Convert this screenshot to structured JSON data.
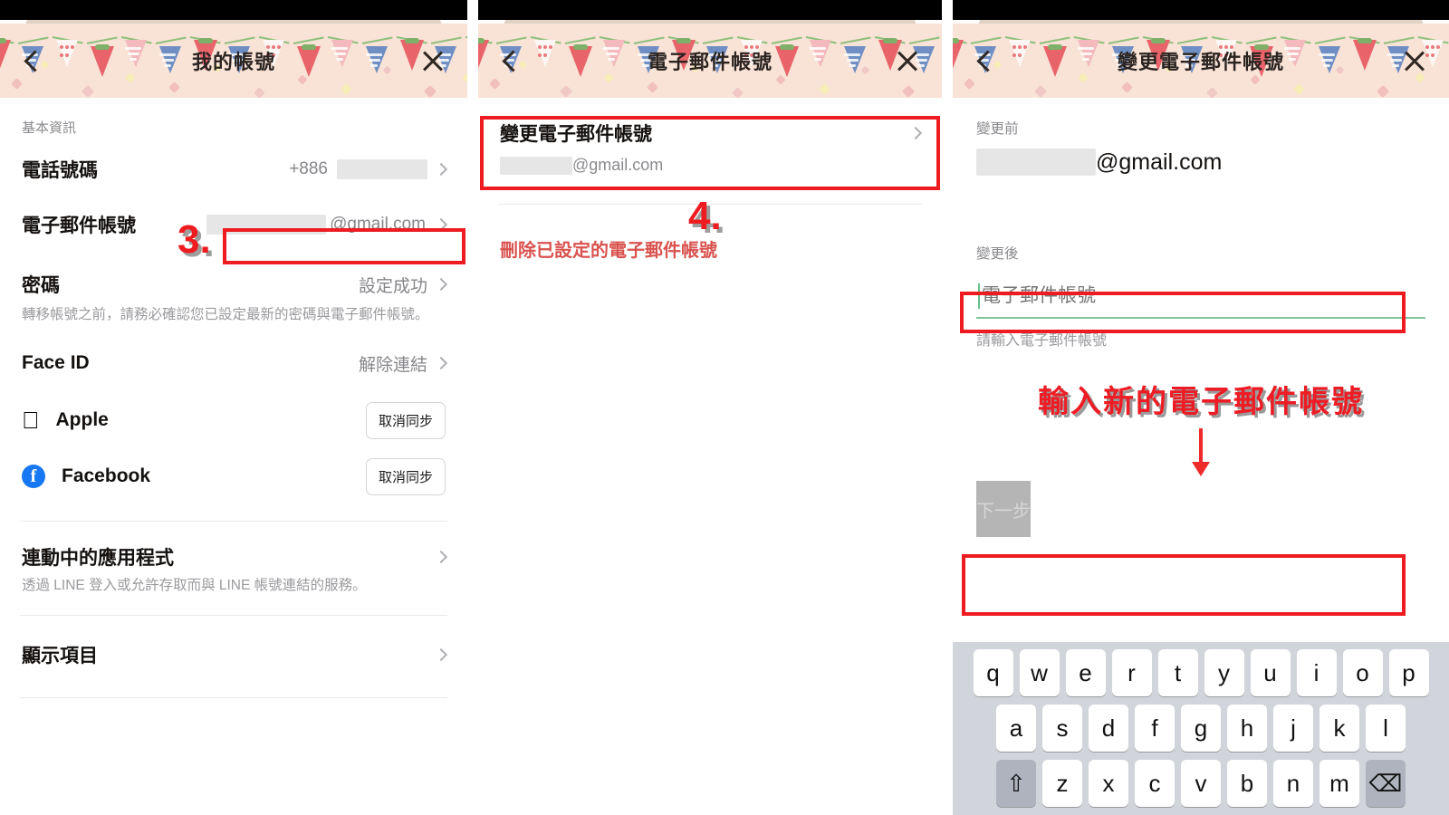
{
  "panels": [
    {
      "id": "my-account",
      "header": {
        "title": "我的帳號",
        "back_icon": "chevron-left-icon",
        "close_icon": "close-icon"
      },
      "section_label": "基本資訊",
      "rows": [
        {
          "title": "電話號碼",
          "value_prefix": "+886",
          "value": "",
          "redacted": true,
          "chevron": true
        },
        {
          "title": "電子郵件帳號",
          "value_prefix": "",
          "value": "@gmail.com",
          "redacted": true,
          "chevron": true
        },
        {
          "title": "密碼",
          "value_prefix": "",
          "value": "設定成功",
          "redacted": false,
          "chevron": true
        }
      ],
      "password_helper": "轉移帳號之前，請務必確認您已設定最新的密碼與電子郵件帳號。",
      "faceid": {
        "title": "Face ID",
        "value": "解除連結",
        "chevron": true
      },
      "brands": [
        {
          "name": "Apple",
          "icon": "apple-logo-icon",
          "button": "取消同步"
        },
        {
          "name": "Facebook",
          "icon": "facebook-logo-icon",
          "button": "取消同步"
        }
      ],
      "linked_apps": {
        "title": "連動中的應用程式",
        "helper": "透過 LINE 登入或允許存取而與 LINE 帳號連結的服務。",
        "chevron": true
      },
      "display_items": {
        "title": "顯示項目",
        "chevron": true
      }
    },
    {
      "id": "email-account",
      "header": {
        "title": "電子郵件帳號",
        "back_icon": "chevron-left-icon",
        "close_icon": "close-icon"
      },
      "change_row": {
        "title": "變更電子郵件帳號",
        "subtitle": "@gmail.com",
        "redacted": true,
        "chevron": true
      },
      "delete_note": "刪除已設定的電子郵件帳號"
    },
    {
      "id": "change-email",
      "header": {
        "title": "變更電子郵件帳號",
        "back_icon": "chevron-left-icon",
        "close_icon": "close-icon"
      },
      "before_label": "變更前",
      "before_value": "@gmail.com",
      "after_label": "變更後",
      "input_placeholder": "電子郵件帳號",
      "input_value": "",
      "input_hint": "請輸入電子郵件帳號",
      "annotation": "輸入新的電子郵件帳號",
      "next_button": "下一步",
      "keyboard": {
        "row1": [
          "q",
          "w",
          "e",
          "r",
          "t",
          "y",
          "u",
          "i",
          "o",
          "p"
        ],
        "row2": [
          "a",
          "s",
          "d",
          "f",
          "g",
          "h",
          "j",
          "k",
          "l"
        ],
        "row3": [
          "⇧",
          "z",
          "x",
          "c",
          "v",
          "b",
          "n",
          "m",
          "⌫"
        ]
      }
    }
  ],
  "annotations": {
    "step3": "3.",
    "step4": "4."
  },
  "colors": {
    "annotation_red": "#ee1b20",
    "note_red": "#d9534f",
    "header_bg": "#f9e2d6",
    "facebook_blue": "#1877f2",
    "input_green": "#7ec79a",
    "disabled_button": "#b5b5b5"
  }
}
